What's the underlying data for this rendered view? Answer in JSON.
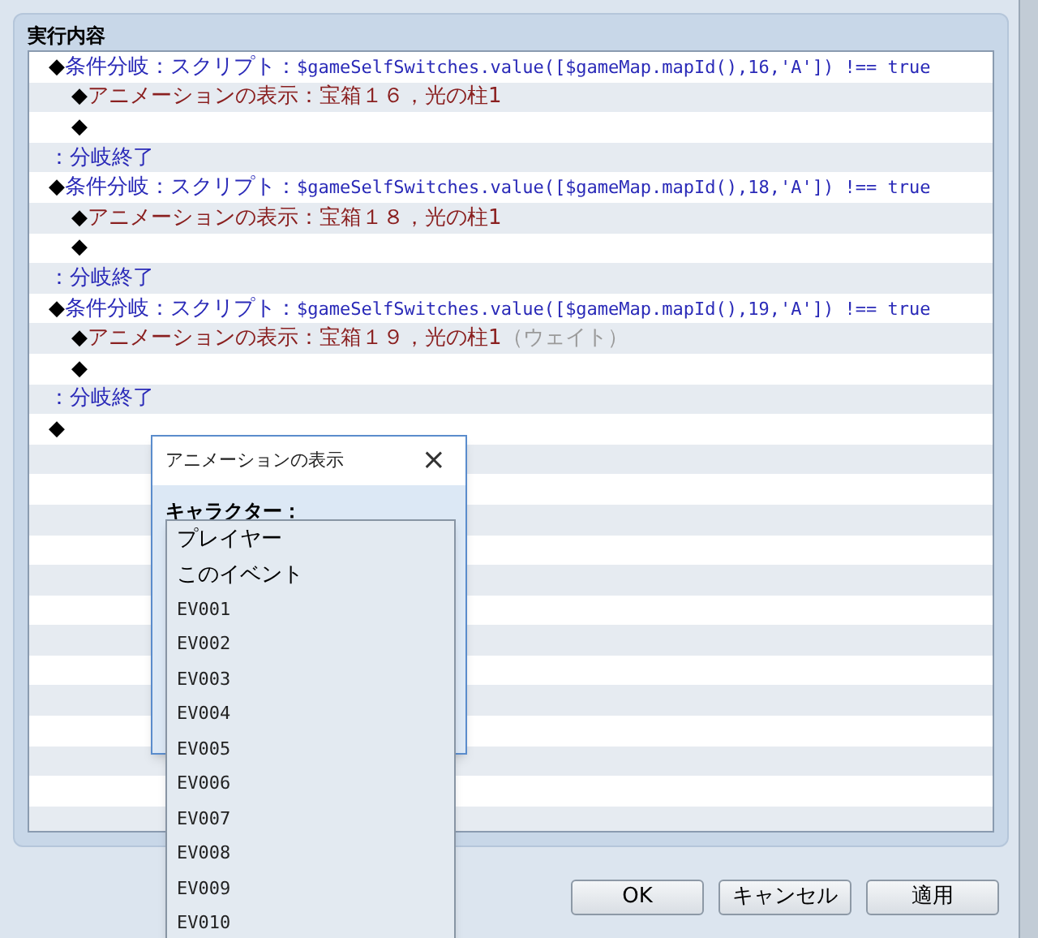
{
  "group": {
    "title": "実行内容"
  },
  "commands": [
    {
      "kind": "branch",
      "marker": "◆",
      "label": "条件分岐：スクリプト：",
      "script": "$gameSelfSwitches.value([$gameMap.mapId(),16,'A']) !== true",
      "children": [
        {
          "kind": "animation",
          "marker": "◆",
          "label": "アニメーションの表示：宝箱１６，光の柱1"
        },
        {
          "kind": "empty",
          "marker": "◆"
        }
      ]
    },
    {
      "kind": "end",
      "label": "：分岐終了"
    },
    {
      "kind": "branch",
      "marker": "◆",
      "label": "条件分岐：スクリプト：",
      "script": "$gameSelfSwitches.value([$gameMap.mapId(),18,'A']) !== true",
      "children": [
        {
          "kind": "animation",
          "marker": "◆",
          "label": "アニメーションの表示：宝箱１８，光の柱1"
        },
        {
          "kind": "empty",
          "marker": "◆"
        }
      ]
    },
    {
      "kind": "end",
      "label": "：分岐終了"
    },
    {
      "kind": "branch",
      "marker": "◆",
      "label": "条件分岐：スクリプト：",
      "script": "$gameSelfSwitches.value([$gameMap.mapId(),19,'A']) !== true",
      "children": [
        {
          "kind": "animation",
          "marker": "◆",
          "label": "アニメーションの表示：宝箱１９，光の柱1",
          "note": "（ウェイト）"
        },
        {
          "kind": "empty",
          "marker": "◆"
        }
      ]
    },
    {
      "kind": "end",
      "label": "：分岐終了"
    },
    {
      "kind": "empty",
      "marker": "◆"
    }
  ],
  "buttons": [
    "OK",
    "キャンセル",
    "適用"
  ],
  "dialog": {
    "title": "アニメーションの表示",
    "close": "×",
    "field_label": "キャラクター：",
    "options": [
      "プレイヤー",
      "このイベント",
      "EV001",
      "EV002",
      "EV003",
      "EV004",
      "EV005",
      "EV006",
      "EV007",
      "EV008",
      "EV009",
      "EV010"
    ]
  }
}
